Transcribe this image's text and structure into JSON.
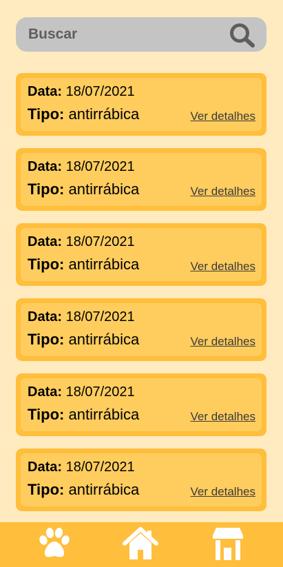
{
  "search": {
    "placeholder": "Buscar",
    "icon": "search-icon"
  },
  "card_labels": {
    "date": "Data:",
    "type": "Tipo:",
    "link": "Ver detalhes"
  },
  "vaccines": [
    {
      "date": "18/07/2021",
      "type": "antirrábica"
    },
    {
      "date": "18/07/2021",
      "type": "antirrábica"
    },
    {
      "date": "18/07/2021",
      "type": "antirrábica"
    },
    {
      "date": "18/07/2021",
      "type": "antirrábica"
    },
    {
      "date": "18/07/2021",
      "type": "antirrábica"
    },
    {
      "date": "18/07/2021",
      "type": "antirrábica"
    }
  ],
  "bottom_nav": [
    {
      "icon": "paw-icon"
    },
    {
      "icon": "home-icon"
    },
    {
      "icon": "store-icon"
    }
  ],
  "colors": {
    "background": "#FFEBBF",
    "card_border": "#FFBE3B",
    "card_fill": "#FFCD5E",
    "search_bg": "#C4C4C4",
    "nav_bg": "#FFBE3B",
    "icon_white": "#FFFFFF"
  }
}
